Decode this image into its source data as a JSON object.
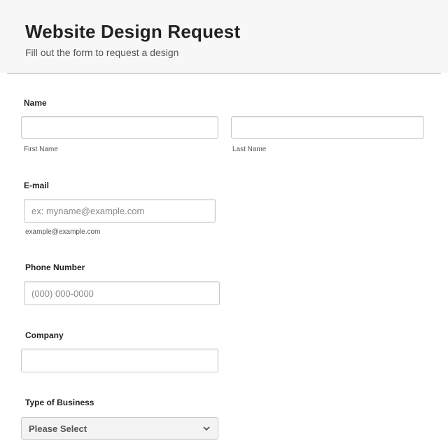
{
  "header": {
    "title": "Website Design Request",
    "subtitle": "Fill out the form to request a design"
  },
  "form": {
    "name": {
      "label": "Name",
      "first": {
        "value": "",
        "placeholder": "",
        "sublabel": "First Name"
      },
      "last": {
        "value": "",
        "placeholder": "",
        "sublabel": "Last Name"
      }
    },
    "email": {
      "label": "E-mail",
      "value": "",
      "placeholder": "ex: myname@example.com",
      "sublabel": "example@example.com"
    },
    "phone": {
      "label": "Phone Number",
      "value": "",
      "placeholder": "(000) 000-0000"
    },
    "company": {
      "label": "Company",
      "value": "",
      "placeholder": ""
    },
    "business_type": {
      "label": "Type of Business",
      "selected": "Please Select",
      "icon": "chevron-down-icon"
    }
  },
  "colors": {
    "background": "#ffffff",
    "header_background": "#f7f7f7",
    "input_border": "#c9c9c9"
  }
}
